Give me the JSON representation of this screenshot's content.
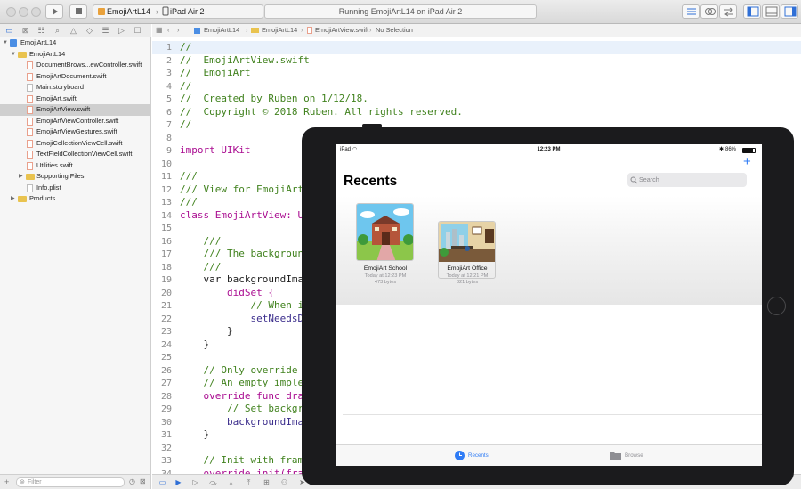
{
  "toolbar": {
    "scheme_name": "EmojiArtL14",
    "device_name": "iPad Air 2",
    "activity_text": "Running EmojiArtL14 on iPad Air 2"
  },
  "navigator": {
    "filter_placeholder": "Filter",
    "items": [
      {
        "label": "EmojiArtL14",
        "kind": "project",
        "level": 0,
        "expanded": true
      },
      {
        "label": "EmojiArtL14",
        "kind": "folder",
        "level": 1,
        "expanded": true
      },
      {
        "label": "DocumentBrows...ewController.swift",
        "kind": "swift",
        "level": 2
      },
      {
        "label": "EmojiArtDocument.swift",
        "kind": "swift",
        "level": 2
      },
      {
        "label": "Main.storyboard",
        "kind": "file",
        "level": 2
      },
      {
        "label": "EmojiArt.swift",
        "kind": "swift",
        "level": 2
      },
      {
        "label": "EmojiArtView.swift",
        "kind": "swift",
        "level": 2,
        "selected": true
      },
      {
        "label": "EmojiArtViewController.swift",
        "kind": "swift",
        "level": 2
      },
      {
        "label": "EmojiArtViewGestures.swift",
        "kind": "swift",
        "level": 2
      },
      {
        "label": "EmojiCollectionViewCell.swift",
        "kind": "swift",
        "level": 2
      },
      {
        "label": "TextFieldCollectionViewCell.swift",
        "kind": "swift",
        "level": 2
      },
      {
        "label": "Utilities.swift",
        "kind": "swift",
        "level": 2
      },
      {
        "label": "Supporting Files",
        "kind": "folder",
        "level": 2,
        "expanded": false
      },
      {
        "label": "Info.plist",
        "kind": "file",
        "level": 2
      },
      {
        "label": "Products",
        "kind": "folder",
        "level": 1,
        "expanded": false
      }
    ]
  },
  "jump_bar": {
    "crumbs": [
      "EmojiArtL14",
      "EmojiArtL14",
      "EmojiArtView.swift",
      "No Selection"
    ]
  },
  "code": {
    "lines": [
      {
        "n": "1",
        "text": "//",
        "cls": "c-comment"
      },
      {
        "n": "2",
        "text": "//  EmojiArtView.swift",
        "cls": "c-comment"
      },
      {
        "n": "3",
        "text": "//  EmojiArt",
        "cls": "c-comment"
      },
      {
        "n": "4",
        "text": "//",
        "cls": "c-comment"
      },
      {
        "n": "5",
        "text": "//  Created by Ruben on 1/12/18.",
        "cls": "c-comment"
      },
      {
        "n": "6",
        "text": "//  Copyright © 2018 Ruben. All rights reserved.",
        "cls": "c-comment"
      },
      {
        "n": "7",
        "text": "//",
        "cls": "c-comment"
      },
      {
        "n": "8",
        "text": "",
        "cls": "c-plain"
      },
      {
        "n": "9",
        "text": "import UIKit",
        "cls": "c-keyword"
      },
      {
        "n": "10",
        "text": "",
        "cls": "c-plain"
      },
      {
        "n": "11",
        "text": "///",
        "cls": "c-comment"
      },
      {
        "n": "12",
        "text": "/// View for EmojiArt",
        "cls": "c-comment"
      },
      {
        "n": "13",
        "text": "///",
        "cls": "c-comment"
      },
      {
        "n": "14",
        "text": "class EmojiArtView: UIView",
        "cls": "c-keyword"
      },
      {
        "n": "15",
        "text": "",
        "cls": "c-plain"
      },
      {
        "n": "16",
        "text": "    ///",
        "cls": "c-comment"
      },
      {
        "n": "17",
        "text": "    /// The background image",
        "cls": "c-comment"
      },
      {
        "n": "18",
        "text": "    ///",
        "cls": "c-comment"
      },
      {
        "n": "19",
        "text": "    var backgroundImage: UIImage?",
        "cls": "c-plain"
      },
      {
        "n": "20",
        "text": "        didSet {",
        "cls": "c-keyword"
      },
      {
        "n": "21",
        "text": "            // When image is set",
        "cls": "c-comment"
      },
      {
        "n": "22",
        "text": "            setNeedsDisplay()",
        "cls": "c-type"
      },
      {
        "n": "23",
        "text": "        }",
        "cls": "c-plain"
      },
      {
        "n": "24",
        "text": "    }",
        "cls": "c-plain"
      },
      {
        "n": "25",
        "text": "",
        "cls": "c-plain"
      },
      {
        "n": "26",
        "text": "    // Only override draw()",
        "cls": "c-comment"
      },
      {
        "n": "27",
        "text": "    // An empty implementation",
        "cls": "c-comment"
      },
      {
        "n": "28",
        "text": "    override func draw(_ rect: CGRect)",
        "cls": "c-keyword"
      },
      {
        "n": "29",
        "text": "        // Set background",
        "cls": "c-comment"
      },
      {
        "n": "30",
        "text": "        backgroundImage?.draw",
        "cls": "c-type"
      },
      {
        "n": "31",
        "text": "    }",
        "cls": "c-plain"
      },
      {
        "n": "32",
        "text": "",
        "cls": "c-plain"
      },
      {
        "n": "33",
        "text": "    // Init with frame",
        "cls": "c-comment"
      },
      {
        "n": "34",
        "text": "    override init(frame: CGRect)",
        "cls": "c-keyword"
      }
    ]
  },
  "simulator": {
    "status_left": "iPad",
    "status_time": "12:23 PM",
    "status_battery": "86%",
    "title": "Recents",
    "search_placeholder": "Search",
    "add_symbol": "+",
    "documents": [
      {
        "name": "EmojiArt School",
        "date": "Today at 12:23 PM",
        "size": "473 bytes"
      },
      {
        "name": "EmojiArt Office",
        "date": "Today at 12:21 PM",
        "size": "821 bytes"
      }
    ],
    "tabs": [
      {
        "label": "Recents",
        "active": true
      },
      {
        "label": "Browse",
        "active": false
      }
    ],
    "colors": {
      "tint": "#2f7cf6",
      "bezel": "#1b1b1d"
    }
  }
}
